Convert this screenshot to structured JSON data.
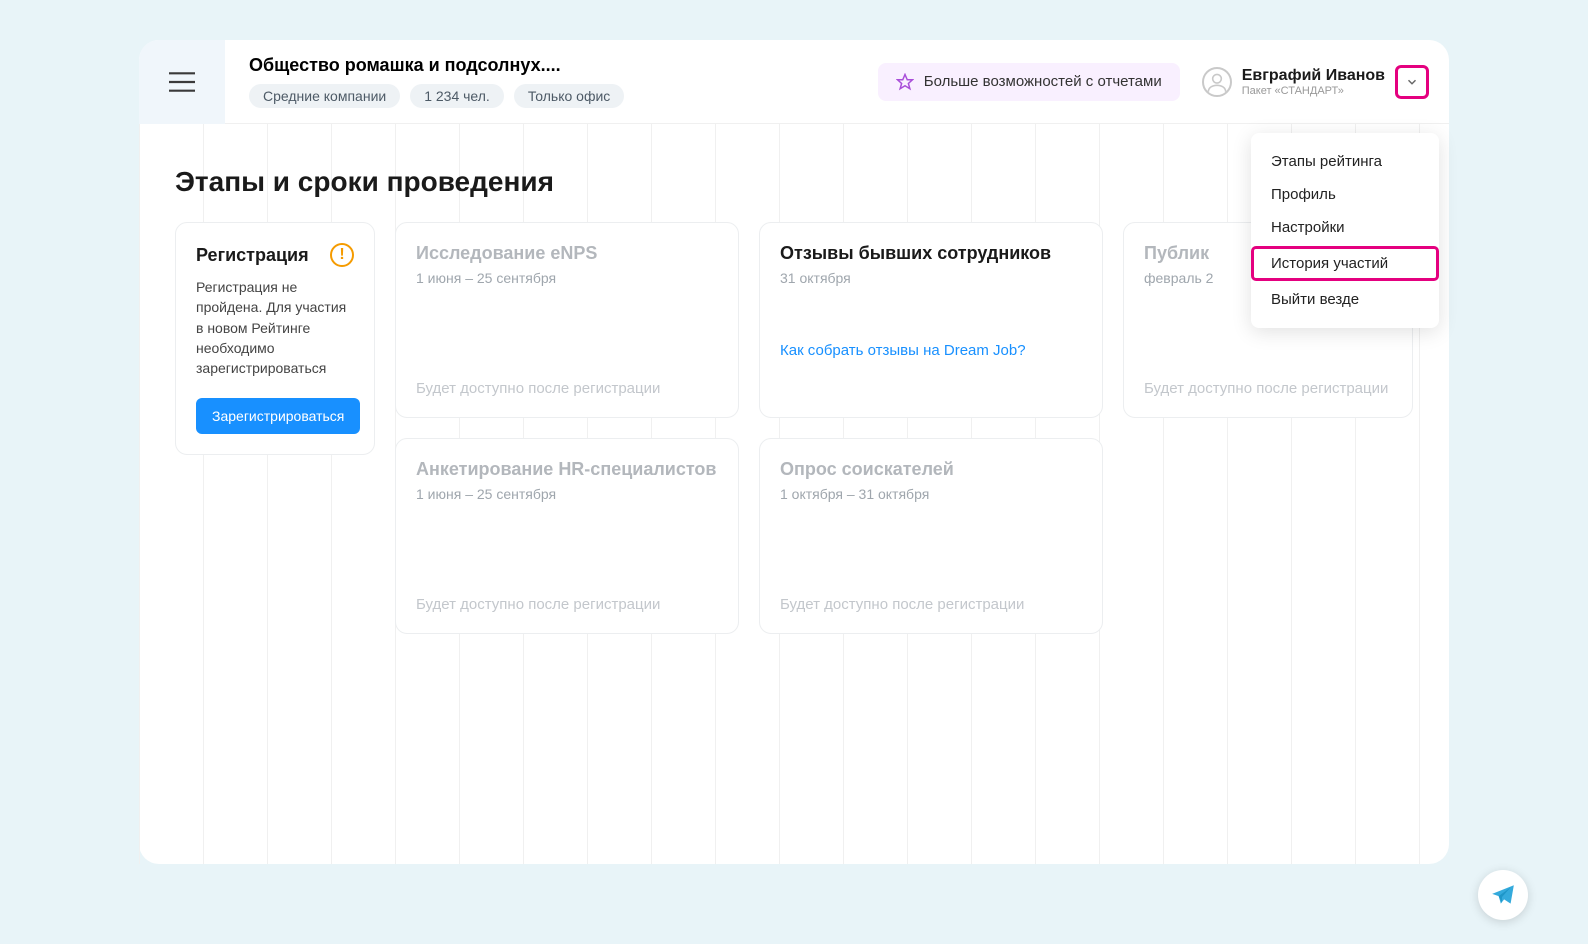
{
  "header": {
    "org_title": "Общество ромашка и подсолнух....",
    "pills": [
      "Средние компании",
      "1 234 чел.",
      "Только офис"
    ],
    "promo_text": "Больше возможностей с отчетами",
    "user_name": "Евграфий Иванов",
    "user_package": "Пакет «СТАНДАРТ»"
  },
  "dropdown": {
    "items": [
      "Этапы рейтинга",
      "Профиль",
      "Настройки",
      "История участий",
      "Выйти везде"
    ]
  },
  "page": {
    "title": "Этапы и сроки проведения"
  },
  "cards": {
    "registration": {
      "title": "Регистрация",
      "desc": "Регистрация не пройдена. Для участия в новом Рейтинге необходимо зарегистрироваться",
      "button": "Зарегистрироваться"
    },
    "enps": {
      "title": "Исследование eNPS",
      "date": "1 июня – 25 сентября",
      "footer": "Будет доступно после регистрации"
    },
    "hr": {
      "title": "Анкетирование HR-специалистов",
      "date": "1 июня – 25 сентября",
      "footer": "Будет доступно после регистрации"
    },
    "feedback": {
      "title": "Отзывы бывших сотрудников",
      "date": "31 октября",
      "link": "Как собрать отзывы на Dream Job?"
    },
    "seekers": {
      "title": "Опрос соискателей",
      "date": "1 октября – 31 октября",
      "footer": "Будет доступно после регистрации"
    },
    "publication": {
      "title": "Публик",
      "date": "февраль 2",
      "footer": "Будет доступно после регистрации"
    }
  }
}
